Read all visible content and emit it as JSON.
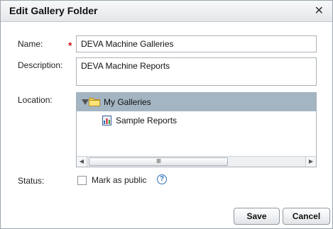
{
  "dialog": {
    "title": "Edit Gallery Folder",
    "close_glyph": "✕"
  },
  "form": {
    "name_label": "Name:",
    "required_marker": "*",
    "name_value": "DEVA Machine Galleries",
    "description_label": "Description:",
    "description_value": "DEVA Machine Reports",
    "location_label": "Location:",
    "status_label": "Status:"
  },
  "tree": {
    "root": {
      "label": "My Galleries",
      "icon": "folder-icon",
      "expanded": true,
      "selected": true
    },
    "children": [
      {
        "label": "Sample Reports",
        "icon": "report-icon"
      }
    ],
    "scroll_left_glyph": "◀",
    "scroll_right_glyph": "▶",
    "scroll_grip": "IIIII"
  },
  "status": {
    "checkbox_label": "Mark as public",
    "checked": false,
    "help_glyph": "?"
  },
  "buttons": {
    "save_label": "Save",
    "cancel_label": "Cancel"
  },
  "colors": {
    "selection": "#a3b5c2",
    "required": "#d0181f",
    "help": "#2f71b8"
  }
}
